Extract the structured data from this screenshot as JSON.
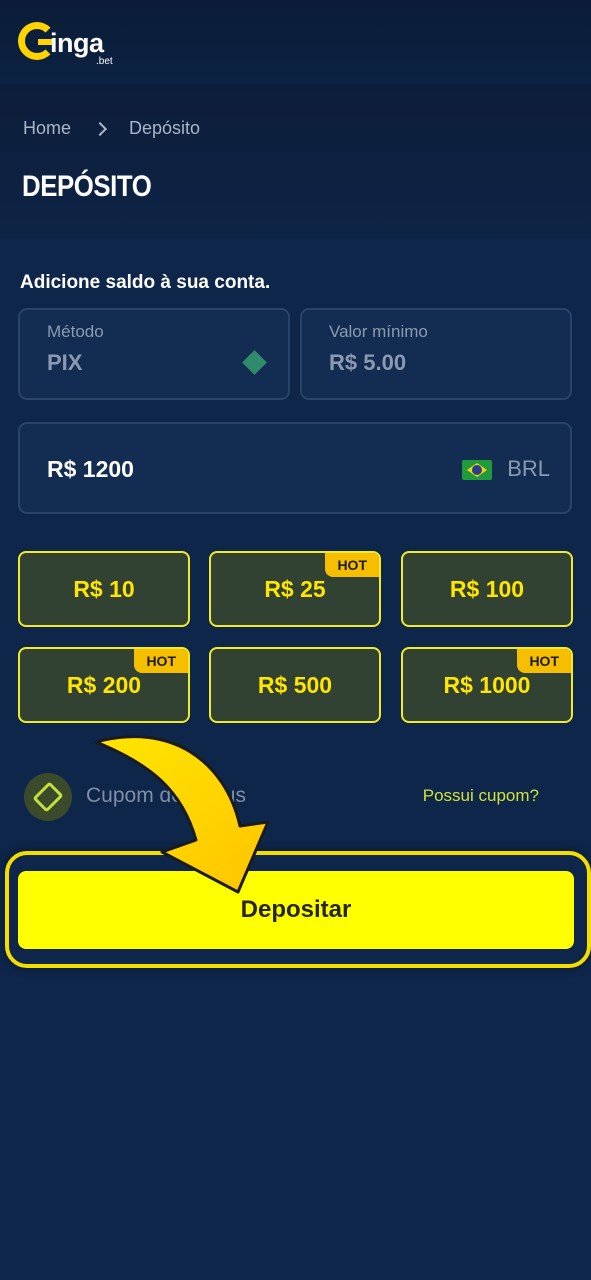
{
  "brand": {
    "logo_word": "inga",
    "logo_sub": ".bet"
  },
  "breadcrumb": {
    "home": "Home",
    "current": "Depósito"
  },
  "page_title": "DEPÓSITO",
  "subtitle": "Adicione saldo à sua conta.",
  "method": {
    "label": "Método",
    "value": "PIX",
    "icon": "pix-icon"
  },
  "minimum": {
    "label": "Valor mínimo",
    "value": "R$ 5.00"
  },
  "amount": {
    "value": "R$ 1200",
    "currency": "BRL",
    "flag": "brazil-flag-icon"
  },
  "presets": [
    {
      "label": "R$ 10",
      "hot": ""
    },
    {
      "label": "R$ 25",
      "hot": "HOT"
    },
    {
      "label": "R$ 100",
      "hot": ""
    },
    {
      "label": "R$ 200",
      "hot": "HOT"
    },
    {
      "label": "R$ 500",
      "hot": ""
    },
    {
      "label": "R$ 1000",
      "hot": "HOT"
    }
  ],
  "coupon": {
    "label": "Cupom de bônus",
    "link": "Possui cupom?",
    "icon": "ticket-icon"
  },
  "deposit_button": "Depositar",
  "colors": {
    "accent": "#ffff00",
    "hot_badge": "#f5bf00",
    "background": "#0d2447"
  }
}
